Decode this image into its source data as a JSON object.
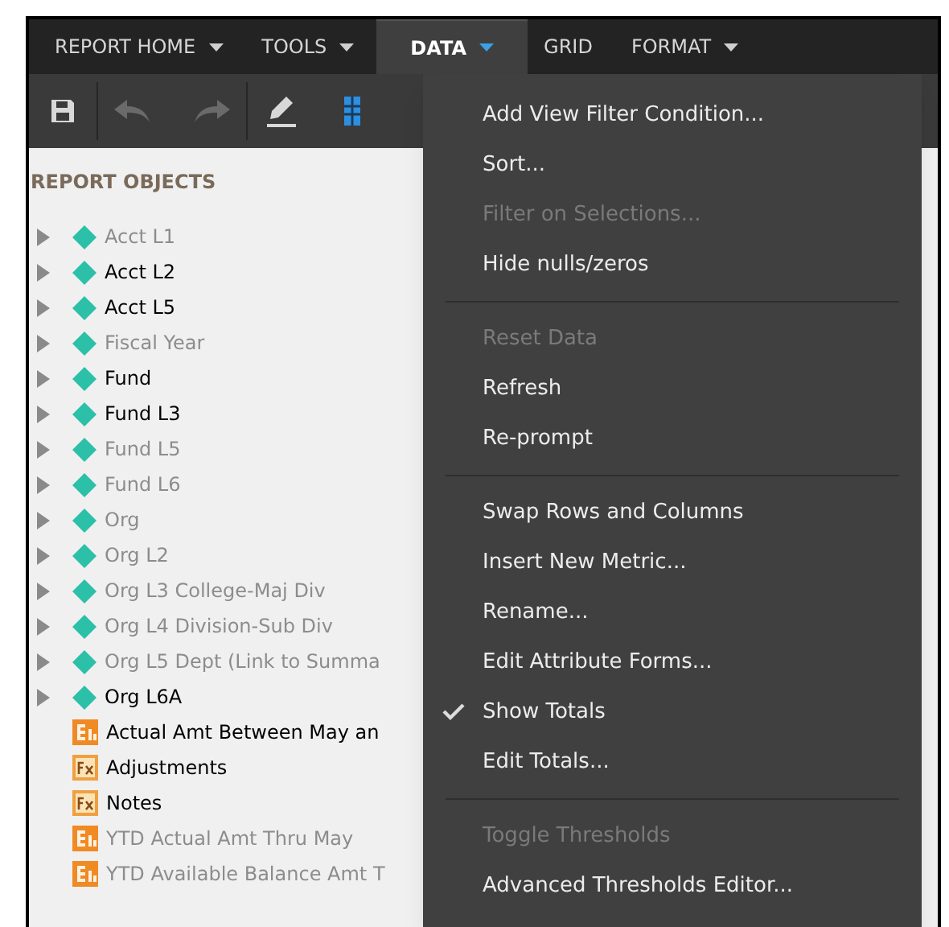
{
  "menu_bar": [
    {
      "label": "REPORT HOME",
      "selected": false,
      "has_menu": true
    },
    {
      "label": "TOOLS",
      "selected": false,
      "has_menu": true
    },
    {
      "label": "DATA",
      "selected": true,
      "has_menu": true
    },
    {
      "label": "GRID",
      "selected": false,
      "has_menu": false
    },
    {
      "label": "FORMAT",
      "selected": false,
      "has_menu": true
    }
  ],
  "toolbar": [
    {
      "kind": "save",
      "disabled": false
    },
    {
      "kind": "undo",
      "disabled": true
    },
    {
      "kind": "redo",
      "disabled": true
    },
    {
      "kind": "edit",
      "disabled": false
    },
    {
      "kind": "grid",
      "disabled": false
    }
  ],
  "report_objects": {
    "title": "REPORT OBJECTS",
    "items": [
      {
        "label": "Acct L1",
        "kind": "attribute",
        "dimmed": true
      },
      {
        "label": "Acct L2",
        "kind": "attribute",
        "dimmed": false
      },
      {
        "label": "Acct L5",
        "kind": "attribute",
        "dimmed": false
      },
      {
        "label": "Fiscal Year",
        "kind": "attribute",
        "dimmed": true
      },
      {
        "label": "Fund",
        "kind": "attribute",
        "dimmed": false
      },
      {
        "label": "Fund L3",
        "kind": "attribute",
        "dimmed": false
      },
      {
        "label": "Fund L5",
        "kind": "attribute",
        "dimmed": true
      },
      {
        "label": "Fund L6",
        "kind": "attribute",
        "dimmed": true
      },
      {
        "label": "Org",
        "kind": "attribute",
        "dimmed": true
      },
      {
        "label": "Org L2",
        "kind": "attribute",
        "dimmed": true
      },
      {
        "label": "Org L3 College-Maj Div",
        "kind": "attribute",
        "dimmed": true
      },
      {
        "label": "Org L4 Division-Sub Div",
        "kind": "attribute",
        "dimmed": true
      },
      {
        "label": "Org L5 Dept (Link to Summa",
        "kind": "attribute",
        "dimmed": true
      },
      {
        "label": "Org L6A",
        "kind": "attribute",
        "dimmed": false
      },
      {
        "label": "Actual Amt Between May an",
        "kind": "metric",
        "dimmed": false
      },
      {
        "label": "Adjustments",
        "kind": "formula",
        "dimmed": false
      },
      {
        "label": "Notes",
        "kind": "formula",
        "dimmed": false
      },
      {
        "label": "YTD Actual Amt Thru May",
        "kind": "metric",
        "dimmed": true
      },
      {
        "label": "YTD Available Balance Amt T",
        "kind": "metric",
        "dimmed": true
      }
    ]
  },
  "data_menu": [
    {
      "kind": "item",
      "label": "Add View Filter Condition...",
      "disabled": false,
      "checked": false
    },
    {
      "kind": "item",
      "label": "Sort...",
      "disabled": false,
      "checked": false
    },
    {
      "kind": "item",
      "label": "Filter on Selections...",
      "disabled": true,
      "checked": false
    },
    {
      "kind": "item",
      "label": "Hide nulls/zeros",
      "disabled": false,
      "checked": false
    },
    {
      "kind": "separator"
    },
    {
      "kind": "item",
      "label": "Reset Data",
      "disabled": true,
      "checked": false
    },
    {
      "kind": "item",
      "label": "Refresh",
      "disabled": false,
      "checked": false
    },
    {
      "kind": "item",
      "label": "Re-prompt",
      "disabled": false,
      "checked": false
    },
    {
      "kind": "separator"
    },
    {
      "kind": "item",
      "label": "Swap Rows and Columns",
      "disabled": false,
      "checked": false
    },
    {
      "kind": "item",
      "label": "Insert New Metric...",
      "disabled": false,
      "checked": false
    },
    {
      "kind": "item",
      "label": "Rename...",
      "disabled": false,
      "checked": false
    },
    {
      "kind": "item",
      "label": "Edit Attribute Forms...",
      "disabled": false,
      "checked": false
    },
    {
      "kind": "item",
      "label": "Show Totals",
      "disabled": false,
      "checked": true
    },
    {
      "kind": "item",
      "label": "Edit Totals...",
      "disabled": false,
      "checked": false
    },
    {
      "kind": "separator"
    },
    {
      "kind": "item",
      "label": "Toggle Thresholds",
      "disabled": true,
      "checked": false
    },
    {
      "kind": "item",
      "label": "Advanced Thresholds Editor...",
      "disabled": false,
      "checked": false
    }
  ]
}
